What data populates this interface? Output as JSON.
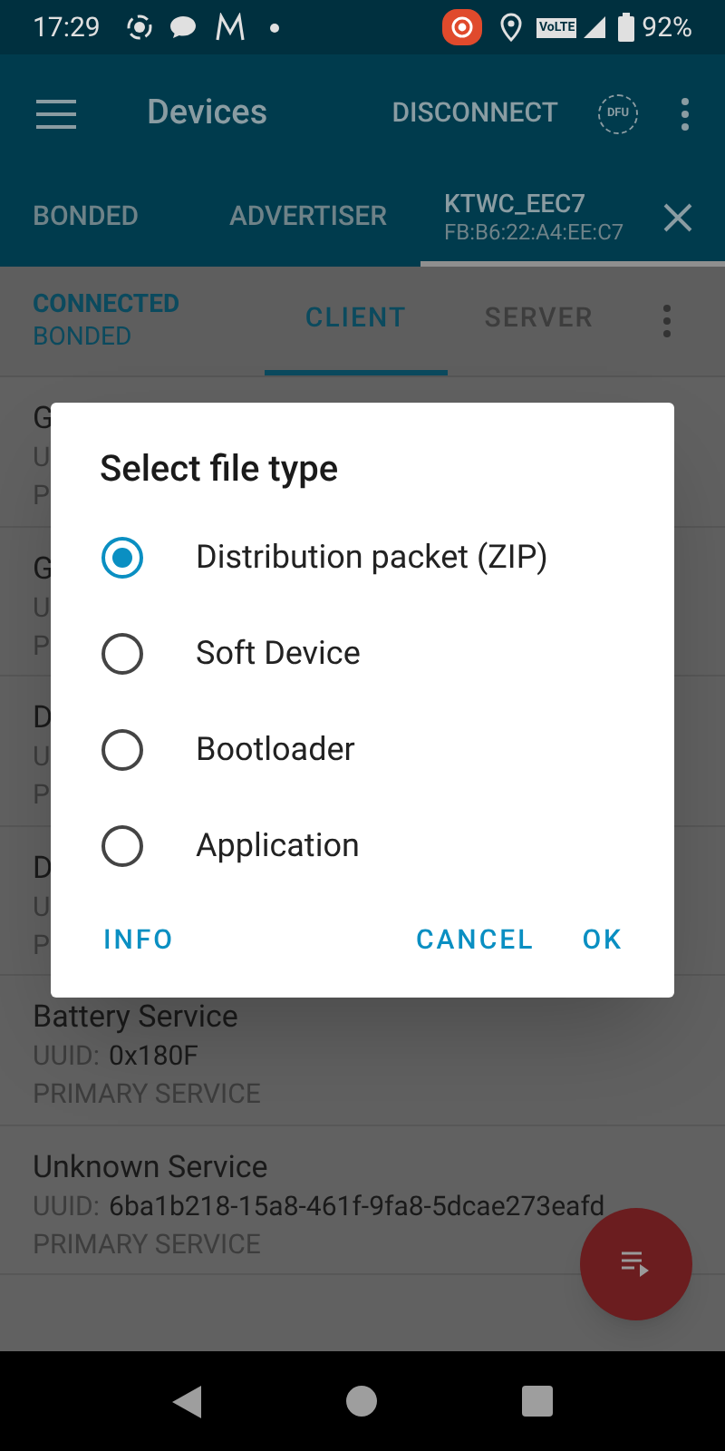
{
  "status_bar": {
    "time": "17:29",
    "volte": "VoLTE",
    "battery": "92%"
  },
  "toolbar": {
    "title": "Devices",
    "action": "DISCONNECT",
    "dfu": "DFU"
  },
  "tabs": [
    {
      "label": "BONDED",
      "selected": false
    },
    {
      "label": "ADVERTISER",
      "selected": false
    },
    {
      "label": "KTWC_EEC7",
      "address": "FB:B6:22:A4:EE:C7",
      "selected": true
    }
  ],
  "connection": {
    "state": "CONNECTED",
    "bond": "BONDED"
  },
  "sub_tabs": [
    {
      "label": "CLIENT",
      "selected": true
    },
    {
      "label": "SERVER",
      "selected": false
    }
  ],
  "services": [
    {
      "name": "G",
      "uuid_label": "U",
      "type": "P"
    },
    {
      "name": "G",
      "uuid_label": "U",
      "type": "P"
    },
    {
      "name": "D",
      "uuid_label": "U",
      "type": "P"
    },
    {
      "name": "D",
      "uuid_label": "U",
      "type": "P"
    },
    {
      "name": "Battery Service",
      "uuid_label": "UUID:",
      "uuid": "0x180F",
      "type": "PRIMARY SERVICE"
    },
    {
      "name": "Unknown Service",
      "uuid_label": "UUID:",
      "uuid": "6ba1b218-15a8-461f-9fa8-5dcae273eafd",
      "type": "PRIMARY SERVICE"
    }
  ],
  "dialog": {
    "title": "Select file type",
    "options": [
      {
        "label": "Distribution packet (ZIP)",
        "selected": true
      },
      {
        "label": "Soft Device",
        "selected": false
      },
      {
        "label": "Bootloader",
        "selected": false
      },
      {
        "label": "Application",
        "selected": false
      }
    ],
    "buttons": {
      "neutral": "INFO",
      "negative": "CANCEL",
      "positive": "OK"
    }
  }
}
